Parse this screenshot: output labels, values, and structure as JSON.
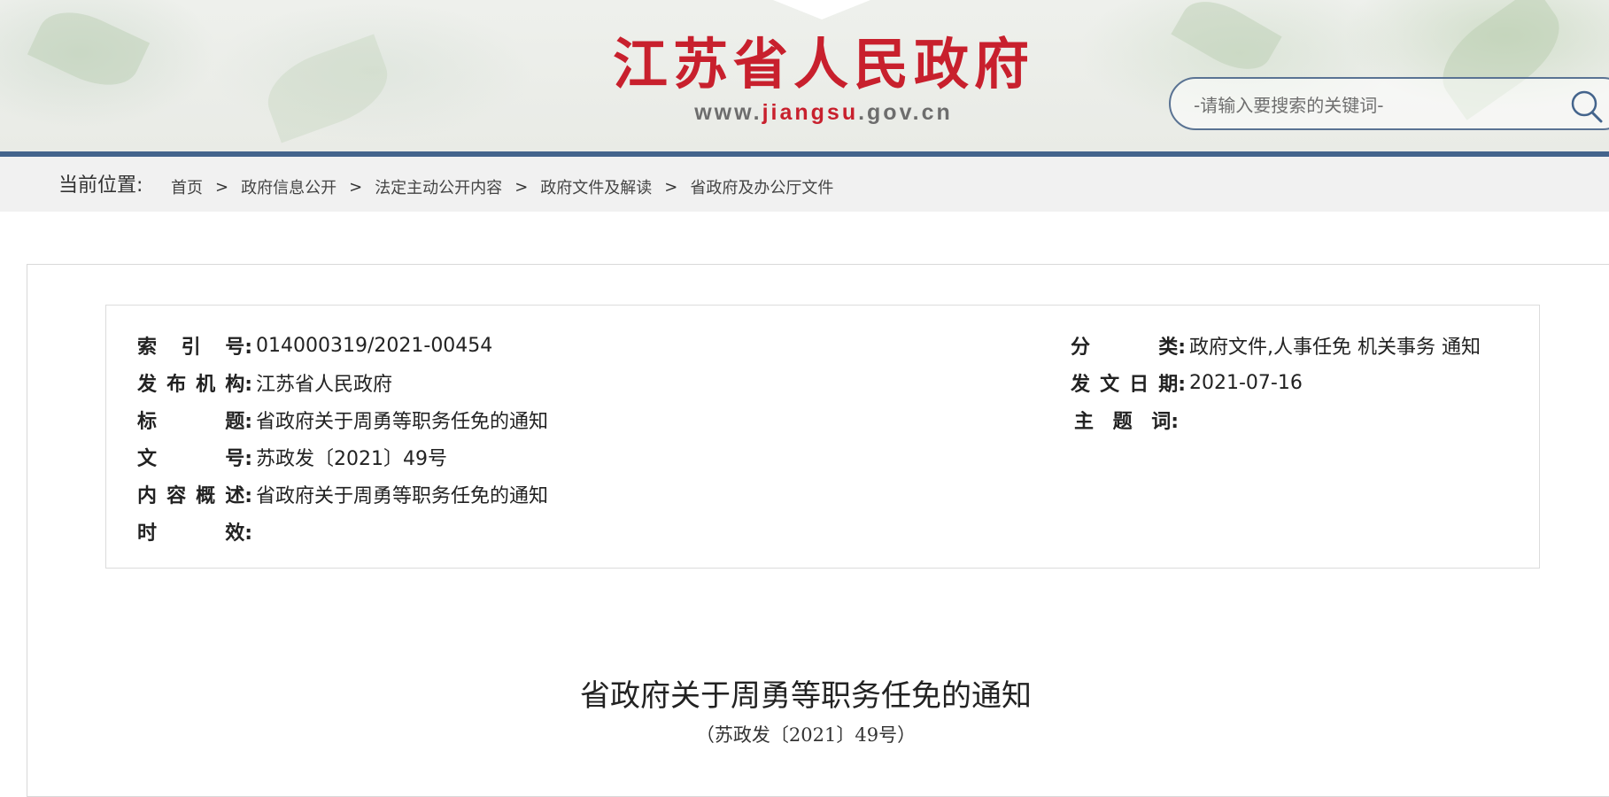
{
  "header": {
    "site_title": "江苏省人民政府",
    "url_prefix": "www.",
    "url_highlight": "jiangsu",
    "url_suffix": ".gov.cn",
    "search_placeholder": "-请输入要搜索的关键词-",
    "search_icon": "search-icon",
    "brand_color": "#c8202d",
    "bar_color": "#44648c"
  },
  "breadcrumb": {
    "label": "当前位置:",
    "separator": ">",
    "items": [
      "首页",
      "政府信息公开",
      "法定主动公开内容",
      "政府文件及解读",
      "省政府及办公厅文件"
    ]
  },
  "meta": {
    "left": [
      {
        "label": [
          "索",
          "引",
          "号:"
        ],
        "value": "014000319/2021-00454"
      },
      {
        "label": [
          "发",
          "布",
          "机",
          "构:"
        ],
        "value": "江苏省人民政府"
      },
      {
        "label": [
          "标",
          "题:"
        ],
        "value": "省政府关于周勇等职务任免的通知"
      },
      {
        "label": [
          "文",
          "号:"
        ],
        "value": "苏政发〔2021〕49号"
      },
      {
        "label": [
          "内",
          "容",
          "概",
          "述:"
        ],
        "value": "省政府关于周勇等职务任免的通知"
      },
      {
        "label": [
          "时",
          "效:"
        ],
        "value": ""
      }
    ],
    "right": [
      {
        "label": [
          "分",
          "类:"
        ],
        "value": "政府文件,人事任免 机关事务 通知"
      },
      {
        "label": [
          "发",
          "文",
          "日",
          "期:"
        ],
        "value": "2021-07-16"
      },
      {
        "label": [
          "主",
          "题",
          "词:"
        ],
        "value": ""
      }
    ]
  },
  "document": {
    "title": "省政府关于周勇等职务任免的通知",
    "number": "（苏政发〔2021〕49号）"
  }
}
